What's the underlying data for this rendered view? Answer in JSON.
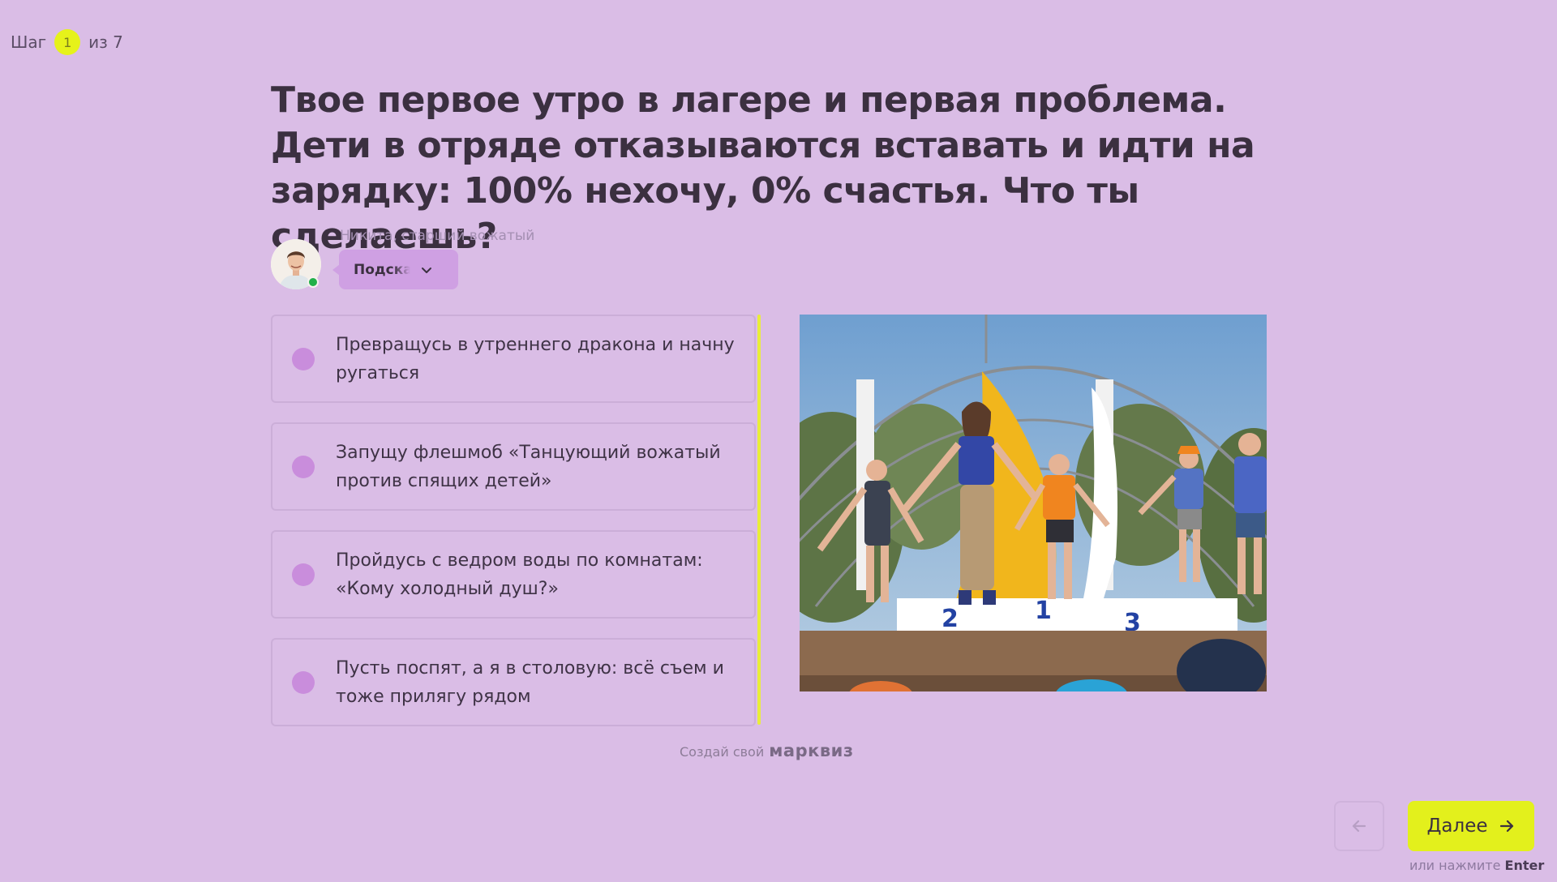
{
  "step": {
    "prefix": "Шаг",
    "current": "1",
    "suffix": "из 7"
  },
  "question": "Твое первое утро в лагере и первая проблема. Дети в отряде отказываются вставать и идти на зарядку: 100% нехочу, 0% счастья. Что ты сделаешь?",
  "hint": {
    "author": "Никита, старший вожатый",
    "button_label": "Подсказка"
  },
  "options": [
    {
      "text": "Превращусь в утреннего дракона и начну ругаться"
    },
    {
      "text": "Запущу флешмоб «Танцующий вожатый против спящих детей»"
    },
    {
      "text": "Пройдусь с ведром воды по комнатам: «Кому холодный душ?»"
    },
    {
      "text": "Пусть поспят, а я в столовую: всё съем и тоже прилягу рядом"
    }
  ],
  "footer": {
    "made_with": "Создай свой",
    "brand": "марквиз"
  },
  "nav": {
    "next_label": "Далее",
    "enter_hint_prefix": "или нажмите",
    "enter_key": "Enter"
  },
  "colors": {
    "background": "#dabde6",
    "accent": "#e3f01c",
    "radio": "#c98ddc"
  }
}
